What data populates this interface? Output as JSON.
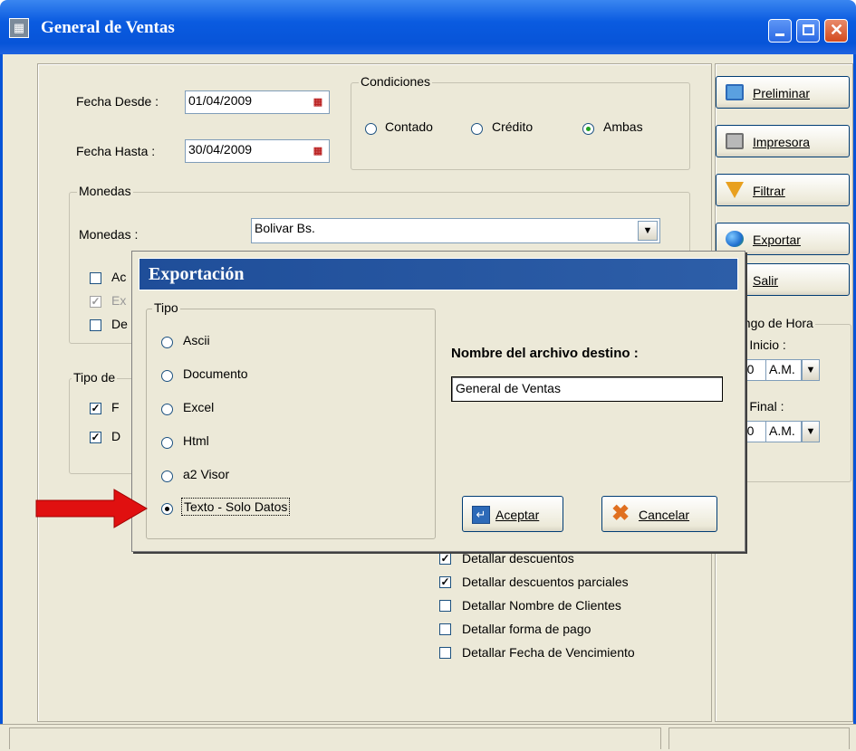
{
  "window": {
    "title": "General de Ventas",
    "icon": "app-icon"
  },
  "filters": {
    "fecha_desde_label": "Fecha Desde :",
    "fecha_desde_value": "01/04/2009",
    "fecha_hasta_label": "Fecha Hasta :",
    "fecha_hasta_value": "30/04/2009",
    "condiciones_legend": "Condiciones",
    "condiciones": [
      {
        "label": "Contado",
        "selected": false
      },
      {
        "label": "Crédito",
        "selected": false
      },
      {
        "label": "Ambas",
        "selected": true
      }
    ]
  },
  "monedas": {
    "legend": "Monedas",
    "label": "Monedas :",
    "selected": "Bolivar Bs.",
    "checks": [
      {
        "label": "Ac",
        "checked": false,
        "disabled": false
      },
      {
        "label": "Ex",
        "checked": true,
        "disabled": true
      },
      {
        "label": "De",
        "checked": false,
        "disabled": false
      }
    ]
  },
  "tipo_doc": {
    "legend": "Tipo de",
    "checks": [
      {
        "label": "F",
        "checked": true
      },
      {
        "label": "D",
        "checked": true
      }
    ]
  },
  "detail_checks": [
    {
      "label": "Detallar descuentos",
      "checked": true
    },
    {
      "label": "Detallar descuentos parciales",
      "checked": true
    },
    {
      "label": "Detallar Nombre de Clientes",
      "checked": false
    },
    {
      "label": "Detallar forma de pago",
      "checked": false
    },
    {
      "label": "Detallar Fecha de  Vencimiento",
      "checked": false
    }
  ],
  "side_buttons": [
    {
      "label": "Preliminar",
      "icon": "monitor-icon"
    },
    {
      "label": "Impresora",
      "icon": "printer-icon"
    },
    {
      "label": "Filtrar",
      "icon": "funnel-icon"
    },
    {
      "label": "Exportar",
      "icon": "globe-icon"
    },
    {
      "label": "Salir",
      "icon": "exit-icon"
    }
  ],
  "rango_hora": {
    "legend": "ango de Hora",
    "inicio_label": "ra Inicio :",
    "inicio_time": ":00",
    "inicio_ampm": "A.M.",
    "final_label": "ra Final :",
    "final_time": ":00",
    "final_ampm": "A.M."
  },
  "export_dialog": {
    "title": "Exportación",
    "tipo_legend": "Tipo",
    "options": [
      {
        "label": "Ascii",
        "selected": false
      },
      {
        "label": "Documento",
        "selected": false
      },
      {
        "label": "Excel",
        "selected": false
      },
      {
        "label": "Html",
        "selected": false
      },
      {
        "label": "a2 Visor",
        "selected": false
      },
      {
        "label": "Texto - Solo Datos",
        "selected": true
      }
    ],
    "dest_label": "Nombre del  archivo destino :",
    "dest_value": "General de Ventas",
    "accept_label": "Aceptar",
    "cancel_label": "Cancelar"
  },
  "colors": {
    "title_blue": "#0754d8",
    "dialog_title": "#2d5ea8",
    "arrow_red": "#e01010"
  }
}
